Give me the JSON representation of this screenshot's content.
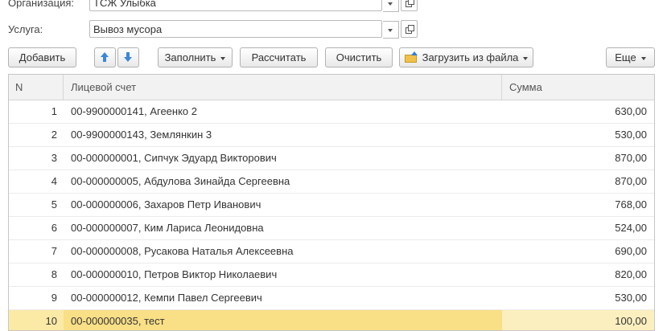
{
  "form": {
    "organization": {
      "label": "Организация:",
      "value": "ТСЖ Улыбка"
    },
    "service": {
      "label": "Услуга:",
      "value": "Вывоз мусора"
    }
  },
  "toolbar": {
    "add": "Добавить",
    "fill": "Заполнить",
    "calculate": "Рассчитать",
    "clear": "Очистить",
    "load_from_file": "Загрузить из файла",
    "more": "Еще"
  },
  "table": {
    "columns": [
      "N",
      "Лицевой счет",
      "Сумма"
    ],
    "rows": [
      {
        "n": "1",
        "account": "00-9900000141, Агеенко 2",
        "sum": "630,00"
      },
      {
        "n": "2",
        "account": "00-9900000143, Землянкин 3",
        "sum": "530,00"
      },
      {
        "n": "3",
        "account": "00-000000001, Сипчук Эдуард Викторович",
        "sum": "870,00"
      },
      {
        "n": "4",
        "account": "00-000000005, Абдулова Зинайда Сергеевна",
        "sum": "870,00"
      },
      {
        "n": "5",
        "account": "00-000000006, Захаров Петр Иванович",
        "sum": "768,00"
      },
      {
        "n": "6",
        "account": "00-000000007, Ким Лариса Леонидовна",
        "sum": "524,00"
      },
      {
        "n": "7",
        "account": "00-000000008, Русакова Наталья Алексеевна",
        "sum": "690,00"
      },
      {
        "n": "8",
        "account": "00-000000010, Петров Виктор Николаевич",
        "sum": "820,00"
      },
      {
        "n": "9",
        "account": "00-000000012, Кемпи Павел Сергеевич",
        "sum": "530,00"
      },
      {
        "n": "10",
        "account": "00-000000035, тест",
        "sum": "100,00"
      }
    ],
    "selected_row": "10"
  },
  "icons": {
    "move_up": "arrow-up-icon",
    "move_down": "arrow-down-icon",
    "load": "folder-upload-icon",
    "open": "open-form-icon",
    "dropdown": "chevron-down-icon"
  },
  "colors": {
    "selection": "#fbeaa6",
    "arrow": "#3b87d8",
    "header_bg": "#f2f2f2",
    "border": "#b9b9b9"
  }
}
